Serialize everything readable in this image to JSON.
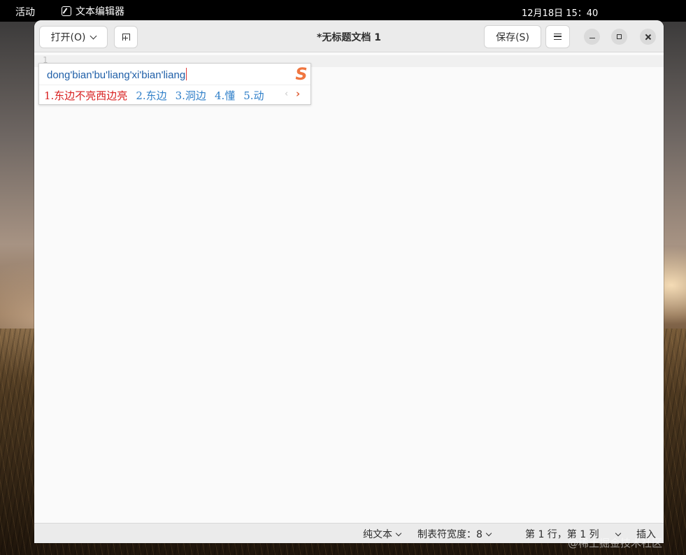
{
  "topbar": {
    "activities": "活动",
    "app_name": "文本编辑器",
    "app_icon": "text-editor-icon",
    "clock": "12月18日  15：40"
  },
  "header": {
    "open_label": "打开(O)",
    "title": "*无标题文档 1",
    "save_label": "保存(S)"
  },
  "editor": {
    "line_number": "1"
  },
  "ime": {
    "pinyin": "dong'bian'bu'liang'xi'bian'liang",
    "logo": "S",
    "candidates": [
      "1.东边不亮西边亮",
      "2.东边",
      "3.洞边",
      "4.懂",
      "5.动"
    ],
    "prev": "‹",
    "next": "›",
    "colors": {
      "selected": "#d82020",
      "candidate": "#2f7fc9",
      "logo": "#f07640"
    }
  },
  "statusbar": {
    "language": "纯文本",
    "tab_width": "制表符宽度：8",
    "position": "第 1 行，第 1 列",
    "mode": "插入"
  },
  "watermark": "@稀土掘金技术社区"
}
